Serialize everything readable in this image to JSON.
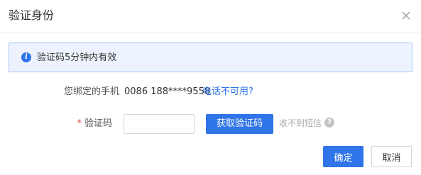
{
  "dialog": {
    "title": "验证身份",
    "close_icon": "close-icon"
  },
  "notice": {
    "icon": "info-icon",
    "icon_glyph": "i",
    "text": "验证码5分钟内有效",
    "accent": "#2f74e8"
  },
  "phone_row": {
    "label": "您绑定的手机",
    "value": "0086 188****9558",
    "link": "电话不可用?"
  },
  "code_row": {
    "required_mark": "*",
    "label": "验证码",
    "input_value": "",
    "input_placeholder": "",
    "get_code_label": "获取验证码",
    "no_sms_text": "收不到短信",
    "help_icon": "question-icon",
    "help_glyph": "?"
  },
  "footer": {
    "ok_label": "确定",
    "cancel_label": "取消"
  },
  "colors": {
    "primary": "#2f74e8",
    "required": "#e5484d"
  }
}
